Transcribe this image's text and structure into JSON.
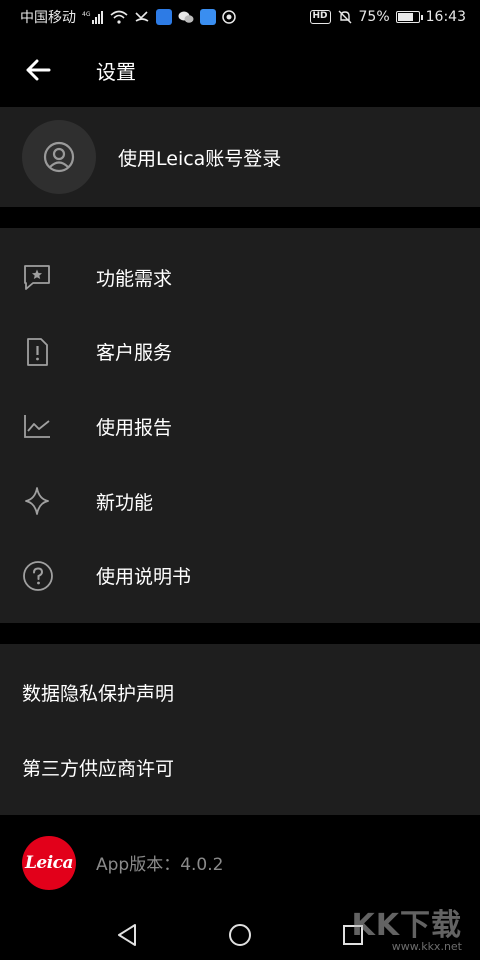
{
  "status_bar": {
    "carrier": "中国移动",
    "network": "4G",
    "battery": "75%",
    "battery_level": 0.75,
    "time": "16:43",
    "hd_badge": "HD"
  },
  "app_bar": {
    "back_icon": "arrow-left-icon",
    "title": "设置"
  },
  "account": {
    "avatar_icon": "user-circle-icon",
    "login_label": "使用Leica账号登录"
  },
  "menu": {
    "items": [
      {
        "icon": "chat-star-icon",
        "label": "功能需求"
      },
      {
        "icon": "document-alert-icon",
        "label": "客户服务"
      },
      {
        "icon": "line-chart-icon",
        "label": "使用报告"
      },
      {
        "icon": "sparkle-icon",
        "label": "新功能"
      },
      {
        "icon": "help-circle-icon",
        "label": "使用说明书"
      }
    ]
  },
  "legal": {
    "items": [
      {
        "label": "数据隐私保护声明"
      },
      {
        "label": "第三方供应商许可"
      }
    ]
  },
  "footer": {
    "logo_text": "Leica",
    "version_label": "App版本：4.0.2",
    "brand_color": "#e2001a"
  },
  "watermark": {
    "logo": "KK下载",
    "url": "www.kkx.net"
  },
  "colors": {
    "background": "#000000",
    "card": "#1e1e1e",
    "text": "#ffffff",
    "muted": "#8a8a8a"
  }
}
